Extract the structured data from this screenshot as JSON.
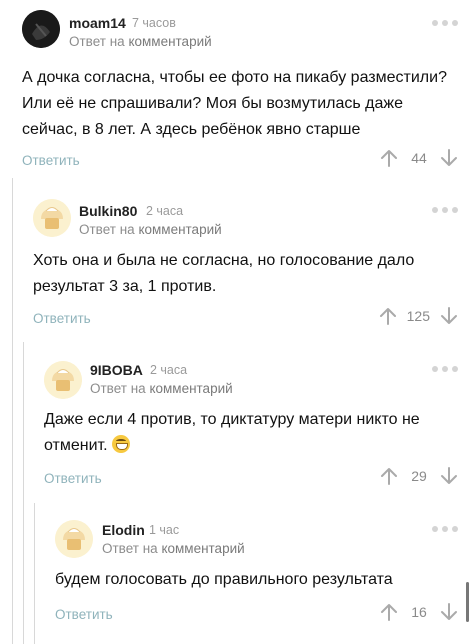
{
  "reply_to_prefix": "Ответ на",
  "reply_to_link": "комментарий",
  "reply_label": "Ответить",
  "comments": [
    {
      "username": "moam14",
      "time": "7 часов",
      "avatar": "dark-photo-avatar",
      "text": "А дочка согласна, чтобы ее фото на пикабу разместили? Или её не спрашивали? Моя бы возмутилась даже сейчас, в 8 лет. А здесь ребёнок явно старше",
      "rating": "44"
    },
    {
      "username": "Bulkin80",
      "time": "2 часа",
      "avatar": "default-pikabu-avatar",
      "text": "Хоть она и была не согласна, но голосование дало результат 3 за, 1 против.",
      "rating": "125"
    },
    {
      "username": "9IBOBA",
      "time": "2 часа",
      "avatar": "default-pikabu-avatar",
      "text": "Даже если 4 против, то диктатуру матери никто не отменит.",
      "emoji": "grinning-face-emoji",
      "rating": "29"
    },
    {
      "username": "Elodin",
      "time": "1 час",
      "avatar": "default-pikabu-avatar",
      "text": "будем голосовать до правильного результата",
      "rating": "16"
    }
  ],
  "colors": {
    "reply_button": "#8fb3bb",
    "muted": "#9a9a9a",
    "rail": "#d8d8d8",
    "avatar_bg": "#fbf1cf"
  }
}
